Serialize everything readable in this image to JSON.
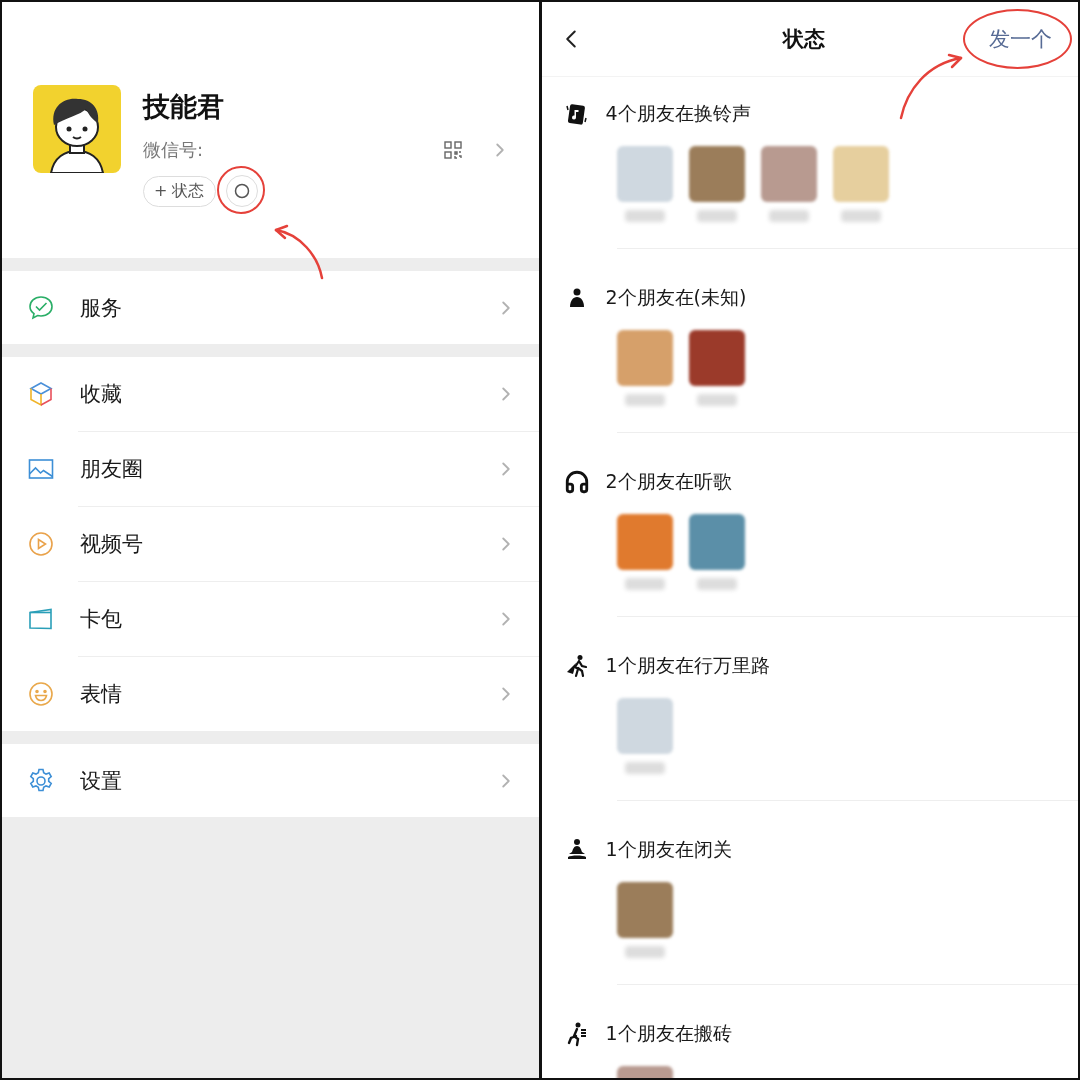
{
  "profile": {
    "name": "技能君",
    "id_label": "微信号:",
    "status_button": "+ 状态"
  },
  "menu_groups": [
    {
      "items": [
        {
          "label": "服务",
          "kind": "services"
        }
      ]
    },
    {
      "items": [
        {
          "label": "收藏",
          "kind": "favorites"
        },
        {
          "label": "朋友圈",
          "kind": "moments"
        },
        {
          "label": "视频号",
          "kind": "channels"
        },
        {
          "label": "卡包",
          "kind": "cards"
        },
        {
          "label": "表情",
          "kind": "stickers"
        }
      ]
    },
    {
      "items": [
        {
          "label": "设置",
          "kind": "settings"
        }
      ]
    }
  ],
  "status_page": {
    "title": "状态",
    "action": "发一个",
    "sections": [
      {
        "kind": "ringtone",
        "title": "4个朋友在换铃声",
        "friends": [
          {
            "kind": "photo"
          },
          {
            "kind": "photo"
          },
          {
            "kind": "photo"
          },
          {
            "kind": "photo"
          }
        ]
      },
      {
        "kind": "unknown",
        "title": "2个朋友在(未知)",
        "friends": [
          {
            "kind": "photo"
          },
          {
            "kind": "photo"
          }
        ]
      },
      {
        "kind": "music",
        "title": "2个朋友在听歌",
        "friends": [
          {
            "kind": "photo"
          },
          {
            "kind": "photo"
          }
        ]
      },
      {
        "kind": "travel",
        "title": "1个朋友在行万里路",
        "friends": [
          {
            "kind": "photo"
          }
        ]
      },
      {
        "kind": "retreat",
        "title": "1个朋友在闭关",
        "friends": [
          {
            "kind": "photo"
          }
        ]
      },
      {
        "kind": "work",
        "title": "1个朋友在搬砖",
        "friends": [
          {
            "kind": "photo"
          }
        ]
      }
    ]
  }
}
